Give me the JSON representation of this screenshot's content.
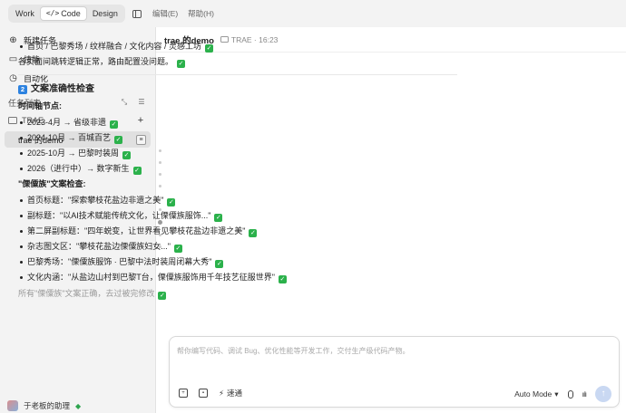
{
  "topbar": {
    "modes": [
      {
        "label": "Work",
        "active": false
      },
      {
        "label": "Code",
        "active": true
      },
      {
        "label": "Design",
        "active": false
      }
    ],
    "menu": [
      "编辑(E)",
      "帮助(H)"
    ]
  },
  "sidebar": {
    "nav": [
      {
        "label": "新建任务",
        "icon": "chat-plus-icon"
      },
      {
        "label": "技能",
        "icon": "book-icon"
      },
      {
        "label": "自动化",
        "icon": "clock-icon"
      }
    ],
    "task_list_title": "任务列表",
    "folder": "TRAE",
    "task": "trae 的demo",
    "user": "于老板的助理"
  },
  "main": {
    "title": "trae 的demo",
    "breadcrumb": "TRAE · 16:23",
    "lines": [
      {
        "type": "bullet",
        "text": "首页 / 巴黎秀场 / 纹样融合 / 文化内容 / 灵感工坊",
        "check": true
      },
      {
        "type": "text",
        "text": "各页面间跳转逻辑正常，路由配置没问题。",
        "check": true
      },
      {
        "type": "divider"
      },
      {
        "type": "h2",
        "num": "2",
        "text": "文案准确性检查"
      },
      {
        "type": "bold",
        "text": "时间轴节点:"
      },
      {
        "type": "bullet",
        "text": "2023-4月 → 省级非遗",
        "check": true
      },
      {
        "type": "bullet",
        "text": "2024-10月 → 百城百艺",
        "check": true
      },
      {
        "type": "bullet",
        "text": "2025-10月 → 巴黎时装周",
        "check": true
      },
      {
        "type": "bullet",
        "text": "2026（进行中）→ 数字新生",
        "check": true
      },
      {
        "type": "bold",
        "text": "\"傈僳族\"文案检查:"
      },
      {
        "type": "bullet",
        "text": "首页标题：\"探索攀枝花盐边非遗之美\"",
        "check": true
      },
      {
        "type": "bullet",
        "text": "副标题：\"以AI技术赋能传统文化，让傈僳族服饰...\"",
        "check": true
      },
      {
        "type": "bullet",
        "text": "第二屏副标题：\"四年蜕变，让世界看见攀枝花盐边非遗之美\"",
        "check": true
      },
      {
        "type": "bullet",
        "text": "杂志图文区：\"攀枝花盐边傈僳族妇女...\"",
        "check": true
      },
      {
        "type": "bullet",
        "text": "巴黎秀场：\"傈僳族服饰 · 巴黎中法时装周闭幕大秀\"",
        "check": true
      },
      {
        "type": "bullet",
        "text": "文化内涵：\"从盐边山村到巴黎T台，傈僳族服饰用千年技艺征服世界\"",
        "check": true
      },
      {
        "type": "faded",
        "text": "所有\"傈僳族\"文案正确，去过被完修改",
        "check": true
      }
    ]
  },
  "input": {
    "placeholder": "帮你编写代码、调试 Bug、优化性能等开发工作，交付生产级代码产物。",
    "quick_label": "速通",
    "mode_label": "Auto Mode"
  }
}
